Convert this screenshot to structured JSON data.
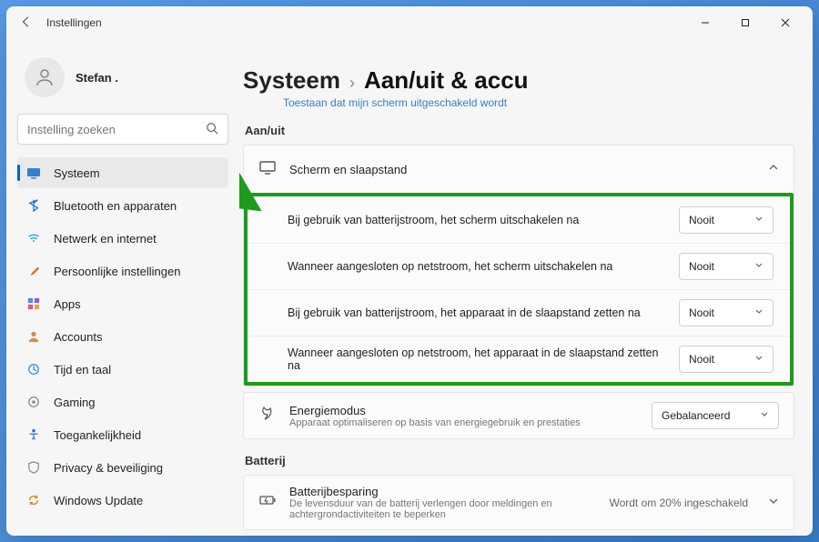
{
  "window": {
    "title": "Instellingen"
  },
  "user": {
    "name": "Stefan ."
  },
  "search": {
    "placeholder": "Instelling zoeken"
  },
  "nav": {
    "items": [
      {
        "label": "Systeem"
      },
      {
        "label": "Bluetooth en apparaten"
      },
      {
        "label": "Netwerk en internet"
      },
      {
        "label": "Persoonlijke instellingen"
      },
      {
        "label": "Apps"
      },
      {
        "label": "Accounts"
      },
      {
        "label": "Tijd en taal"
      },
      {
        "label": "Gaming"
      },
      {
        "label": "Toegankelijkheid"
      },
      {
        "label": "Privacy & beveiliging"
      },
      {
        "label": "Windows Update"
      }
    ]
  },
  "breadcrumb": {
    "parent": "Systeem",
    "sep": "›",
    "current": "Aan/uit & accu"
  },
  "truncated_top": "Toestaan dat mijn scherm uitgeschakeld wordt",
  "sections": {
    "power": {
      "label": "Aan/uit",
      "screen_sleep": {
        "title": "Scherm en slaapstand",
        "rows": [
          {
            "label": "Bij gebruik van batterijstroom, het scherm uitschakelen na",
            "value": "Nooit"
          },
          {
            "label": "Wanneer aangesloten op netstroom, het scherm uitschakelen na",
            "value": "Nooit"
          },
          {
            "label": "Bij gebruik van batterijstroom, het apparaat in de slaapstand zetten na",
            "value": "Nooit"
          },
          {
            "label": "Wanneer aangesloten op netstroom, het apparaat in de slaapstand zetten na",
            "value": "Nooit"
          }
        ]
      },
      "energy": {
        "title": "Energiemodus",
        "subtitle": "Apparaat optimaliseren op basis van energiegebruik en prestaties",
        "value": "Gebalanceerd"
      }
    },
    "battery": {
      "label": "Batterij",
      "saver": {
        "title": "Batterijbesparing",
        "subtitle": "De levensduur van de batterij verlengen door meldingen en achtergrondactiviteiten te beperken",
        "status": "Wordt om 20% ingeschakeld"
      }
    }
  }
}
